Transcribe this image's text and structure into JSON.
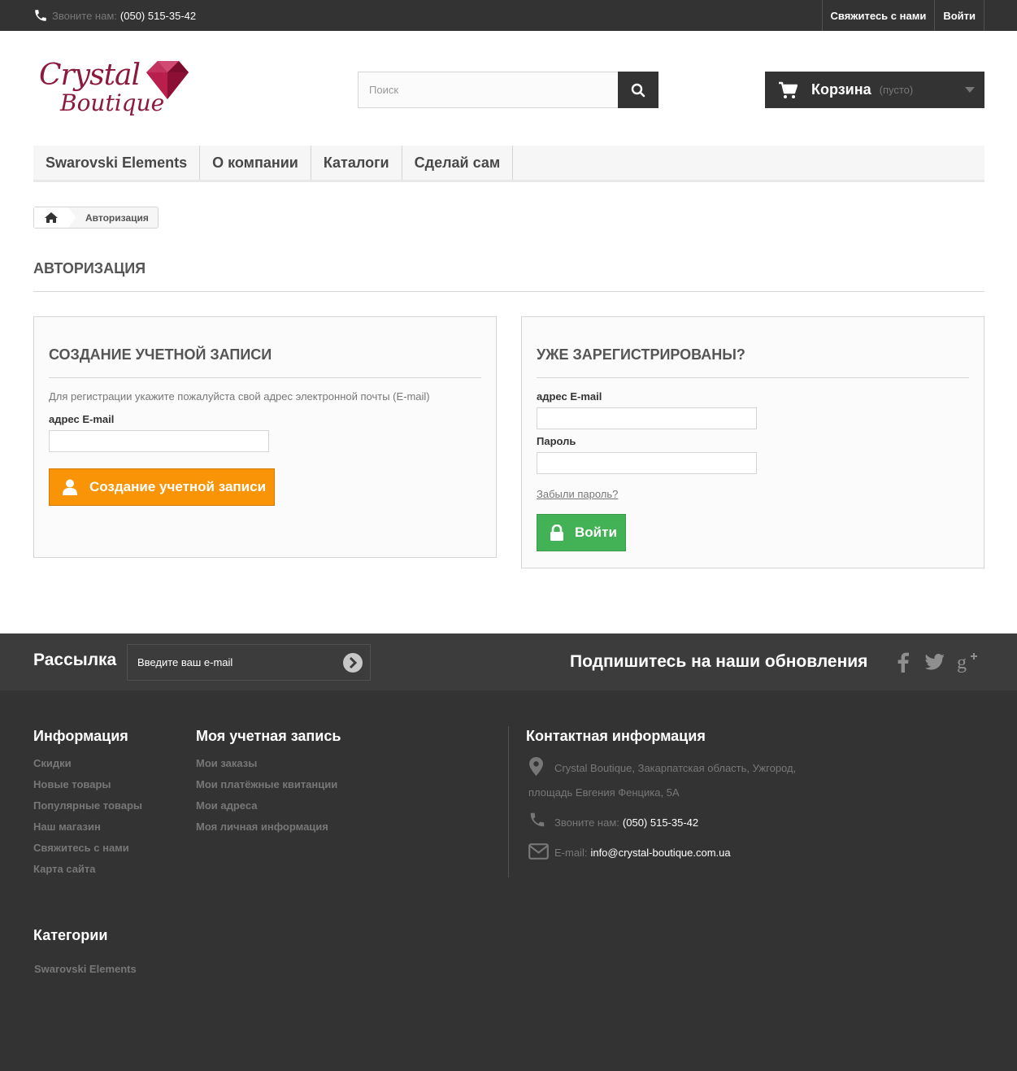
{
  "topbar": {
    "phone_label": "Звоните нам:",
    "phone_number": "(050) 515-35-42",
    "links": [
      "Свяжитесь с нами",
      "Войти"
    ]
  },
  "header": {
    "logo_line1": "Crystal",
    "logo_line2": "Boutique",
    "search_placeholder": "Поиск",
    "cart_label": "Корзина",
    "cart_status": "(пусто)"
  },
  "nav": {
    "items": [
      "Swarovski Elements",
      "О компании",
      "Каталоги",
      "Сделай сам"
    ]
  },
  "breadcrumb": {
    "current": "Авторизация"
  },
  "page": {
    "title": "АВТОРИЗАЦИЯ"
  },
  "create_account": {
    "title": "СОЗДАНИЕ УЧЕТНОЙ ЗАПИСИ",
    "hint": "Для регистрации укажите пожалуйста свой адрес электронной почты (E-mail)",
    "email_label": "адрес E-mail",
    "email_value": "",
    "button_label": "Создание учетной записи"
  },
  "login": {
    "title": "УЖЕ ЗАРЕГИСТРИРОВАНЫ?",
    "email_label": "адрес E-mail",
    "email_value": "",
    "password_label": "Пароль",
    "password_value": "",
    "forgot_label": "Забыли пароль?",
    "button_label": "Войти"
  },
  "newsletter": {
    "title": "Рассылка",
    "placeholder": "Введите ваш e-mail",
    "follow_title": "Подпишитесь на наши обновления",
    "social_icons": [
      "facebook-icon",
      "twitter-icon",
      "google-plus-icon"
    ]
  },
  "footer": {
    "info": {
      "title": "Информация",
      "links": [
        "Скидки",
        "Новые товары",
        "Популярные товары",
        "Наш магазин",
        "Свяжитесь с нами",
        "Карта сайта"
      ]
    },
    "account": {
      "title": "Моя учетная запись",
      "links": [
        "Мои заказы",
        "Мои платёжные квитанции",
        "Мои адреса",
        "Моя личная информация"
      ]
    },
    "contact": {
      "title": "Контактная информация",
      "address_line1": "Crystal Boutique, Закарпатская область, Ужгород,",
      "address_line2": "площадь Евгения Фенцика, 5А",
      "phone_label": "Звоните нам:",
      "phone_number": "(050) 515-35-42",
      "email_label": "E-mail:",
      "email_value": "info@crystal-boutique.com.ua"
    },
    "categories": {
      "title": "Категории",
      "links": [
        "Swarovski Elements"
      ]
    }
  },
  "colors": {
    "dark": "#333333",
    "strip": "#3c3c3c",
    "orange": "#f89406",
    "green": "#43b155",
    "brand": "#8b1a3d"
  }
}
